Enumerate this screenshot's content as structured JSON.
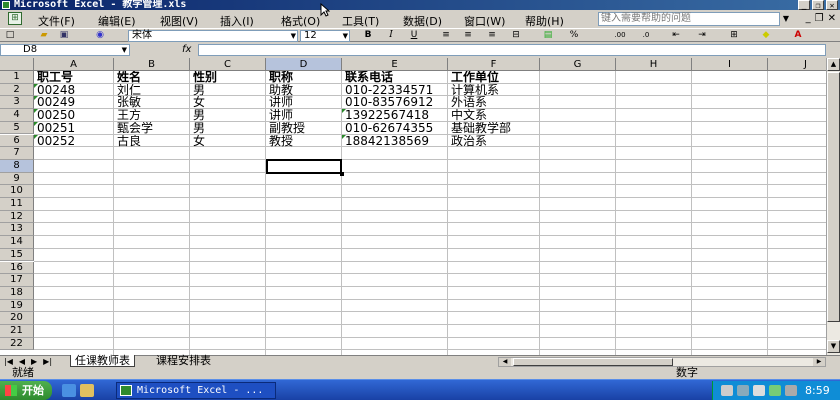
{
  "window": {
    "title": "Microsoft Excel - 教学管理.xls",
    "min_label": "_",
    "restore_label": "❐",
    "close_label": "✕"
  },
  "menubar": {
    "items": [
      "文件(F)",
      "编辑(E)",
      "视图(V)",
      "插入(I)",
      "格式(O)",
      "工具(T)",
      "数据(D)",
      "窗口(W)",
      "帮助(H)"
    ],
    "help_placeholder": "键入需要帮助的问题",
    "doc_min": "_",
    "doc_restore": "❐",
    "doc_close": "✕"
  },
  "toolbar": {
    "font_name": "宋体",
    "font_size": "12",
    "bold": "B",
    "italic": "I",
    "underline": "U",
    "percent": "%",
    "icons": [
      "new-icon",
      "open-icon",
      "save-icon",
      "help-icon",
      "align-left-icon",
      "align-center-icon",
      "align-right-icon",
      "merge-center-icon",
      "currency-icon",
      "percent-icon",
      "decrease-decimal-icon",
      "increase-decimal-icon",
      "decrease-indent-icon",
      "increase-indent-icon",
      "borders-icon",
      "fill-color-icon",
      "font-color-icon"
    ]
  },
  "formula": {
    "cell_ref": "D8",
    "fx": "fx",
    "value": ""
  },
  "columns": [
    "A",
    "B",
    "C",
    "D",
    "E",
    "F",
    "G",
    "H",
    "I",
    "J"
  ],
  "selected_column": "D",
  "selected_row": 8,
  "rows": [
    "1",
    "2",
    "3",
    "4",
    "5",
    "6",
    "7",
    "8",
    "9",
    "10",
    "11",
    "12",
    "13",
    "14",
    "15",
    "16",
    "17",
    "18",
    "19",
    "20",
    "21",
    "22"
  ],
  "table": {
    "headers": [
      "职工号",
      "姓名",
      "性别",
      "职称",
      "联系电话",
      "工作单位"
    ],
    "records": [
      [
        "00248",
        "刘仁",
        "男",
        "助教",
        "010-22334571",
        "计算机系"
      ],
      [
        "00249",
        "张敏",
        "女",
        "讲师",
        "010-83576912",
        "外语系"
      ],
      [
        "00250",
        "王方",
        "男",
        "讲师",
        "13922567418",
        "中文系"
      ],
      [
        "00251",
        "甄会学",
        "男",
        "副教授",
        "010-62674355",
        "基础教学部"
      ],
      [
        "00252",
        "古良",
        "女",
        "教授",
        "18842138569",
        "政治系"
      ]
    ]
  },
  "sheets": {
    "tabs": [
      "任课教师表",
      "课程安排表"
    ],
    "active": "任课教师表"
  },
  "status": {
    "left": "就绪",
    "right": "数字"
  },
  "taskbar": {
    "start_label": "开始",
    "task_label": "Microsoft Excel - ...",
    "clock": "8:59"
  },
  "colors": {
    "titlebar": "#0a246a",
    "chrome": "#d4d0c8",
    "selection_header": "#b6c3dc",
    "taskbar": "#3168d5",
    "start_button": "#2e8b2e"
  }
}
